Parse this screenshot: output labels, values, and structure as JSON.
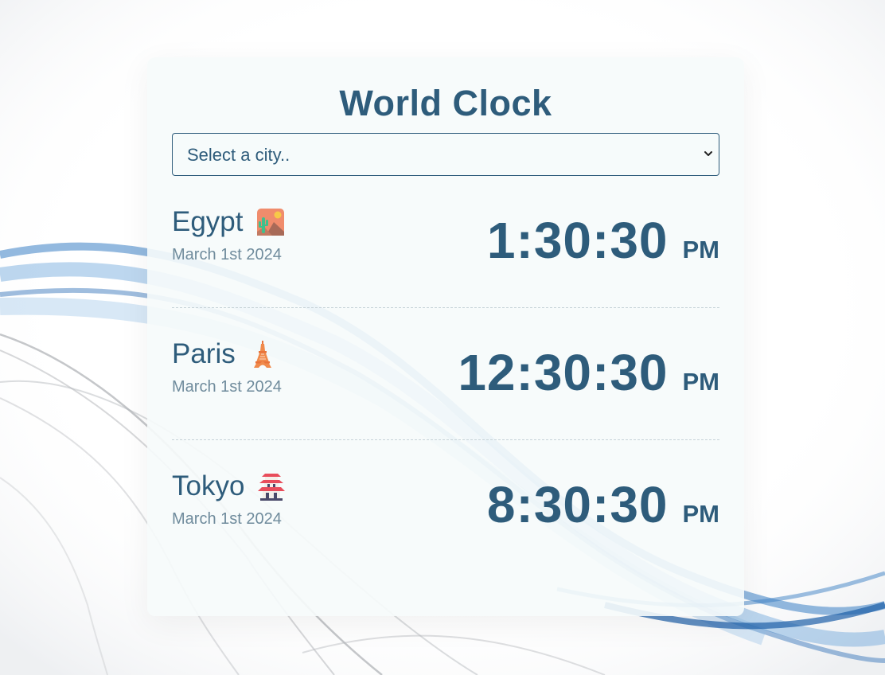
{
  "app": {
    "title": "World Clock"
  },
  "city_select": {
    "placeholder": "Select a city..",
    "icon": "chevron-down-icon"
  },
  "cities": [
    {
      "name": "Egypt",
      "icon": "desert-icon",
      "date": "March 1st 2024",
      "time": "1:30:30",
      "period": "PM"
    },
    {
      "name": "Paris",
      "icon": "eiffel-tower-icon",
      "date": "March 1st 2024",
      "time": "12:30:30",
      "period": "PM"
    },
    {
      "name": "Tokyo",
      "icon": "pagoda-icon",
      "date": "March 1st 2024",
      "time": "8:30:30",
      "period": "PM"
    }
  ],
  "colors": {
    "primary_text": "#2e5c7b",
    "secondary_text": "#6f8b9c",
    "card_background": "#f6fbfb",
    "wave_blue": "#3b7fc4",
    "wave_gray": "#8c8f96"
  }
}
